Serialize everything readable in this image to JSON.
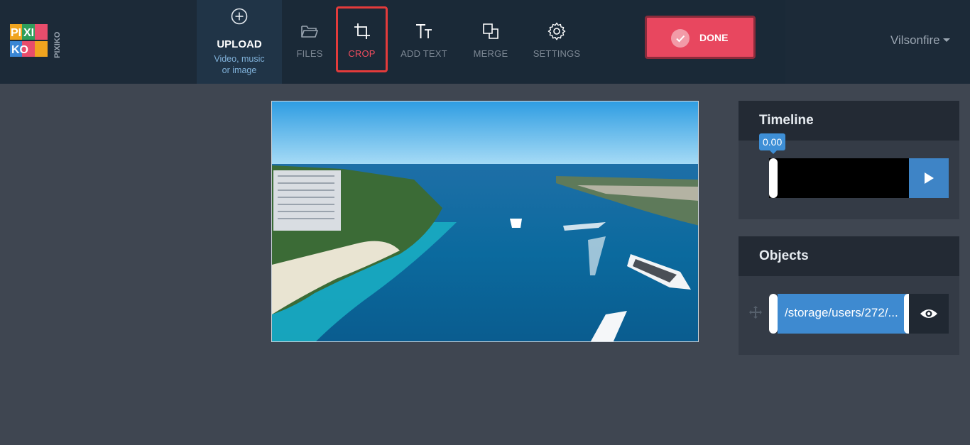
{
  "brand": {
    "logo_letters": [
      "PI",
      "XI",
      "KO"
    ],
    "logo_side_text": "PIXIKO"
  },
  "toolbar": {
    "upload": {
      "title": "UPLOAD",
      "subtitle_line1": "Video, music",
      "subtitle_line2": "or image",
      "icon": "plus-circle-icon"
    },
    "tools": [
      {
        "label": "FILES",
        "icon": "folder-icon"
      },
      {
        "label": "CROP",
        "icon": "crop-icon",
        "active": true
      },
      {
        "label": "ADD TEXT",
        "icon": "text-icon"
      },
      {
        "label": "MERGE",
        "icon": "merge-icon"
      },
      {
        "label": "SETTINGS",
        "icon": "gear-icon"
      }
    ],
    "done_label": "DONE"
  },
  "user": {
    "name": "Vilsonfire"
  },
  "timeline": {
    "title": "Timeline",
    "time": "0.00"
  },
  "objects": {
    "title": "Objects",
    "items": [
      {
        "label": "/storage/users/272/..."
      }
    ]
  },
  "colors": {
    "accent": "#e8475f",
    "crop_highlight": "#e33b3b",
    "blue": "#3e8ad0"
  }
}
